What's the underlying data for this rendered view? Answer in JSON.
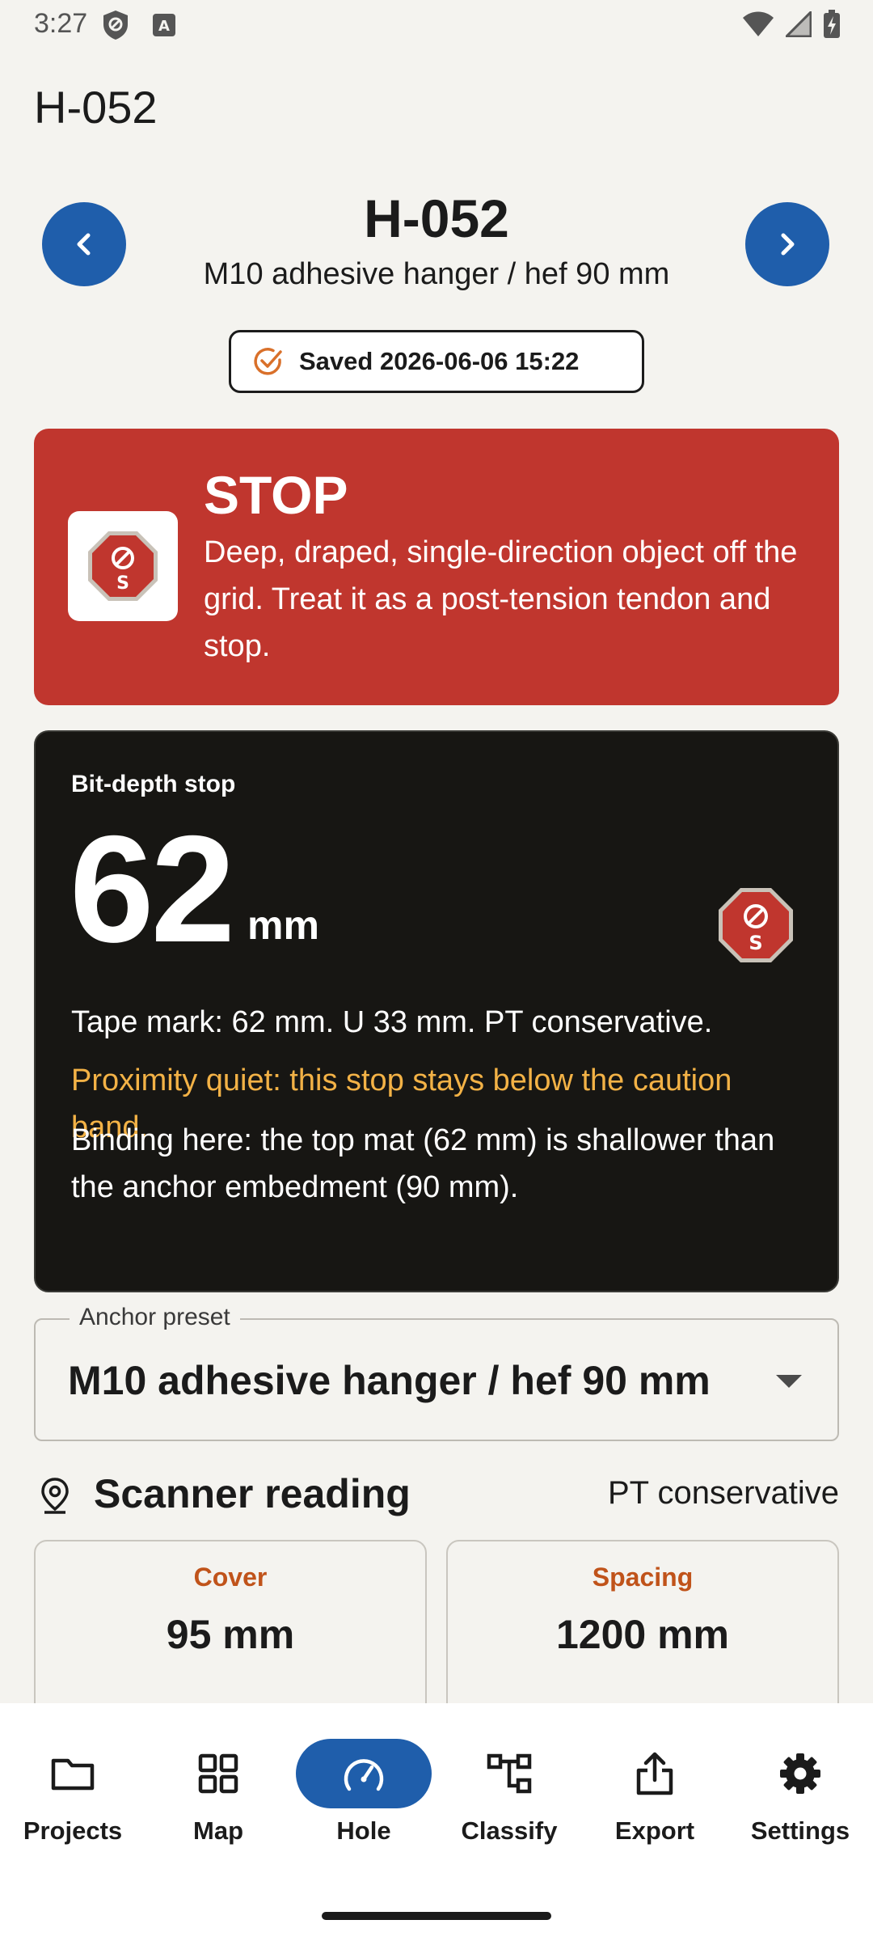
{
  "status_bar": {
    "time": "3:27",
    "left_icons": [
      "shield-icon",
      "keyboard-a-icon"
    ],
    "right_icons": [
      "wifi-icon",
      "signal-icon",
      "battery-charging-icon"
    ]
  },
  "app_bar": {
    "title": "H-052"
  },
  "hole_header": {
    "id": "H-052",
    "subtitle": "M10 adhesive hanger / hef 90 mm",
    "prev_icon": "chevron-left-icon",
    "next_icon": "chevron-right-icon"
  },
  "saved_chip": {
    "text": "Saved 2026-06-06 15:22",
    "icon": "check-circle-icon"
  },
  "stop_card": {
    "title": "STOP",
    "message": "Deep, draped, single-direction object off the grid. Treat it as a post-tension tendon and stop.",
    "icon": "stop-sign-icon",
    "icon_letter": "S"
  },
  "bit_depth": {
    "label": "Bit-depth stop",
    "value": "62",
    "unit": "mm",
    "tape_line": "Tape mark: 62 mm. U 33 mm. PT conservative.",
    "proximity_line": "Proximity quiet: this stop stays below the caution band.",
    "binding_line": "Binding here: the top mat (62 mm) is shallower than the anchor embedment (90 mm).",
    "icon_letter": "S"
  },
  "anchor_preset": {
    "legend": "Anchor preset",
    "selected": "M10 adhesive hanger / hef 90 mm"
  },
  "scanner": {
    "title": "Scanner reading",
    "mode": "PT conservative",
    "cards": [
      {
        "label": "Cover",
        "value": "95 mm"
      },
      {
        "label": "Spacing",
        "value": "1200 mm"
      }
    ]
  },
  "bottom_nav": {
    "items": [
      {
        "label": "Projects",
        "icon": "folder-icon"
      },
      {
        "label": "Map",
        "icon": "grid-icon"
      },
      {
        "label": "Hole",
        "icon": "gauge-icon",
        "active": true
      },
      {
        "label": "Classify",
        "icon": "hierarchy-icon"
      },
      {
        "label": "Export",
        "icon": "share-icon"
      },
      {
        "label": "Settings",
        "icon": "gear-icon"
      }
    ]
  },
  "colors": {
    "accent": "#1f5eab",
    "stop_red": "#c0362e",
    "warning_amber": "#f3b246",
    "label_orange": "#c0531a",
    "dark_card": "#171613"
  }
}
